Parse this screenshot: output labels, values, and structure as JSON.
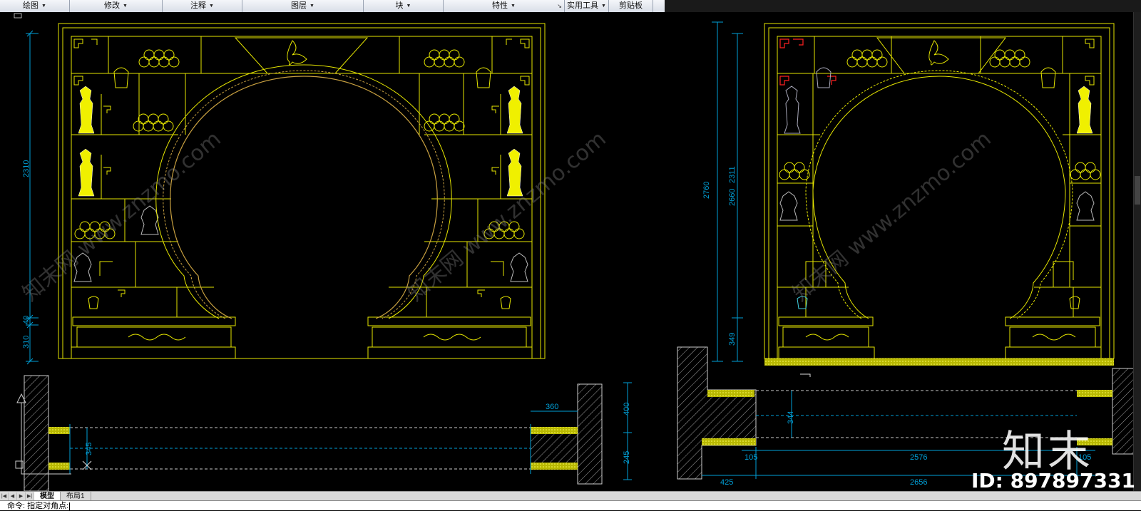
{
  "ribbon": {
    "tabs": [
      {
        "label": "绘图",
        "dropdown": true
      },
      {
        "label": "修改",
        "dropdown": true
      },
      {
        "label": "注释",
        "dropdown": true
      },
      {
        "label": "图层",
        "dropdown": true
      },
      {
        "label": "块",
        "dropdown": true
      },
      {
        "label": "特性",
        "dropdown": true
      },
      {
        "label": "实用工具",
        "dropdown": true
      },
      {
        "label": "剪贴板",
        "dropdown": false
      }
    ]
  },
  "drawing": {
    "dims_left": [
      "2310",
      "40",
      "310"
    ],
    "dims_right": [
      "2760",
      "2660",
      "2311",
      "349"
    ],
    "plan_left": [
      "360",
      "345",
      "400",
      "245"
    ],
    "plan_right": [
      "344",
      "105",
      "2576",
      "105",
      "425",
      "2656"
    ],
    "colors": {
      "line": "#e6e600",
      "dim": "#00a0d8",
      "shelf_fill": "#c8c800",
      "hatch": "#d0d0d0",
      "arch": "#c0a040"
    }
  },
  "layout_tabs": [
    "模型",
    "布局1"
  ],
  "command_line": "命令: 指定对角点:",
  "watermark": {
    "logo": "知末",
    "id": "ID: 897897331",
    "site": "知末网 www.znzmo.com"
  }
}
